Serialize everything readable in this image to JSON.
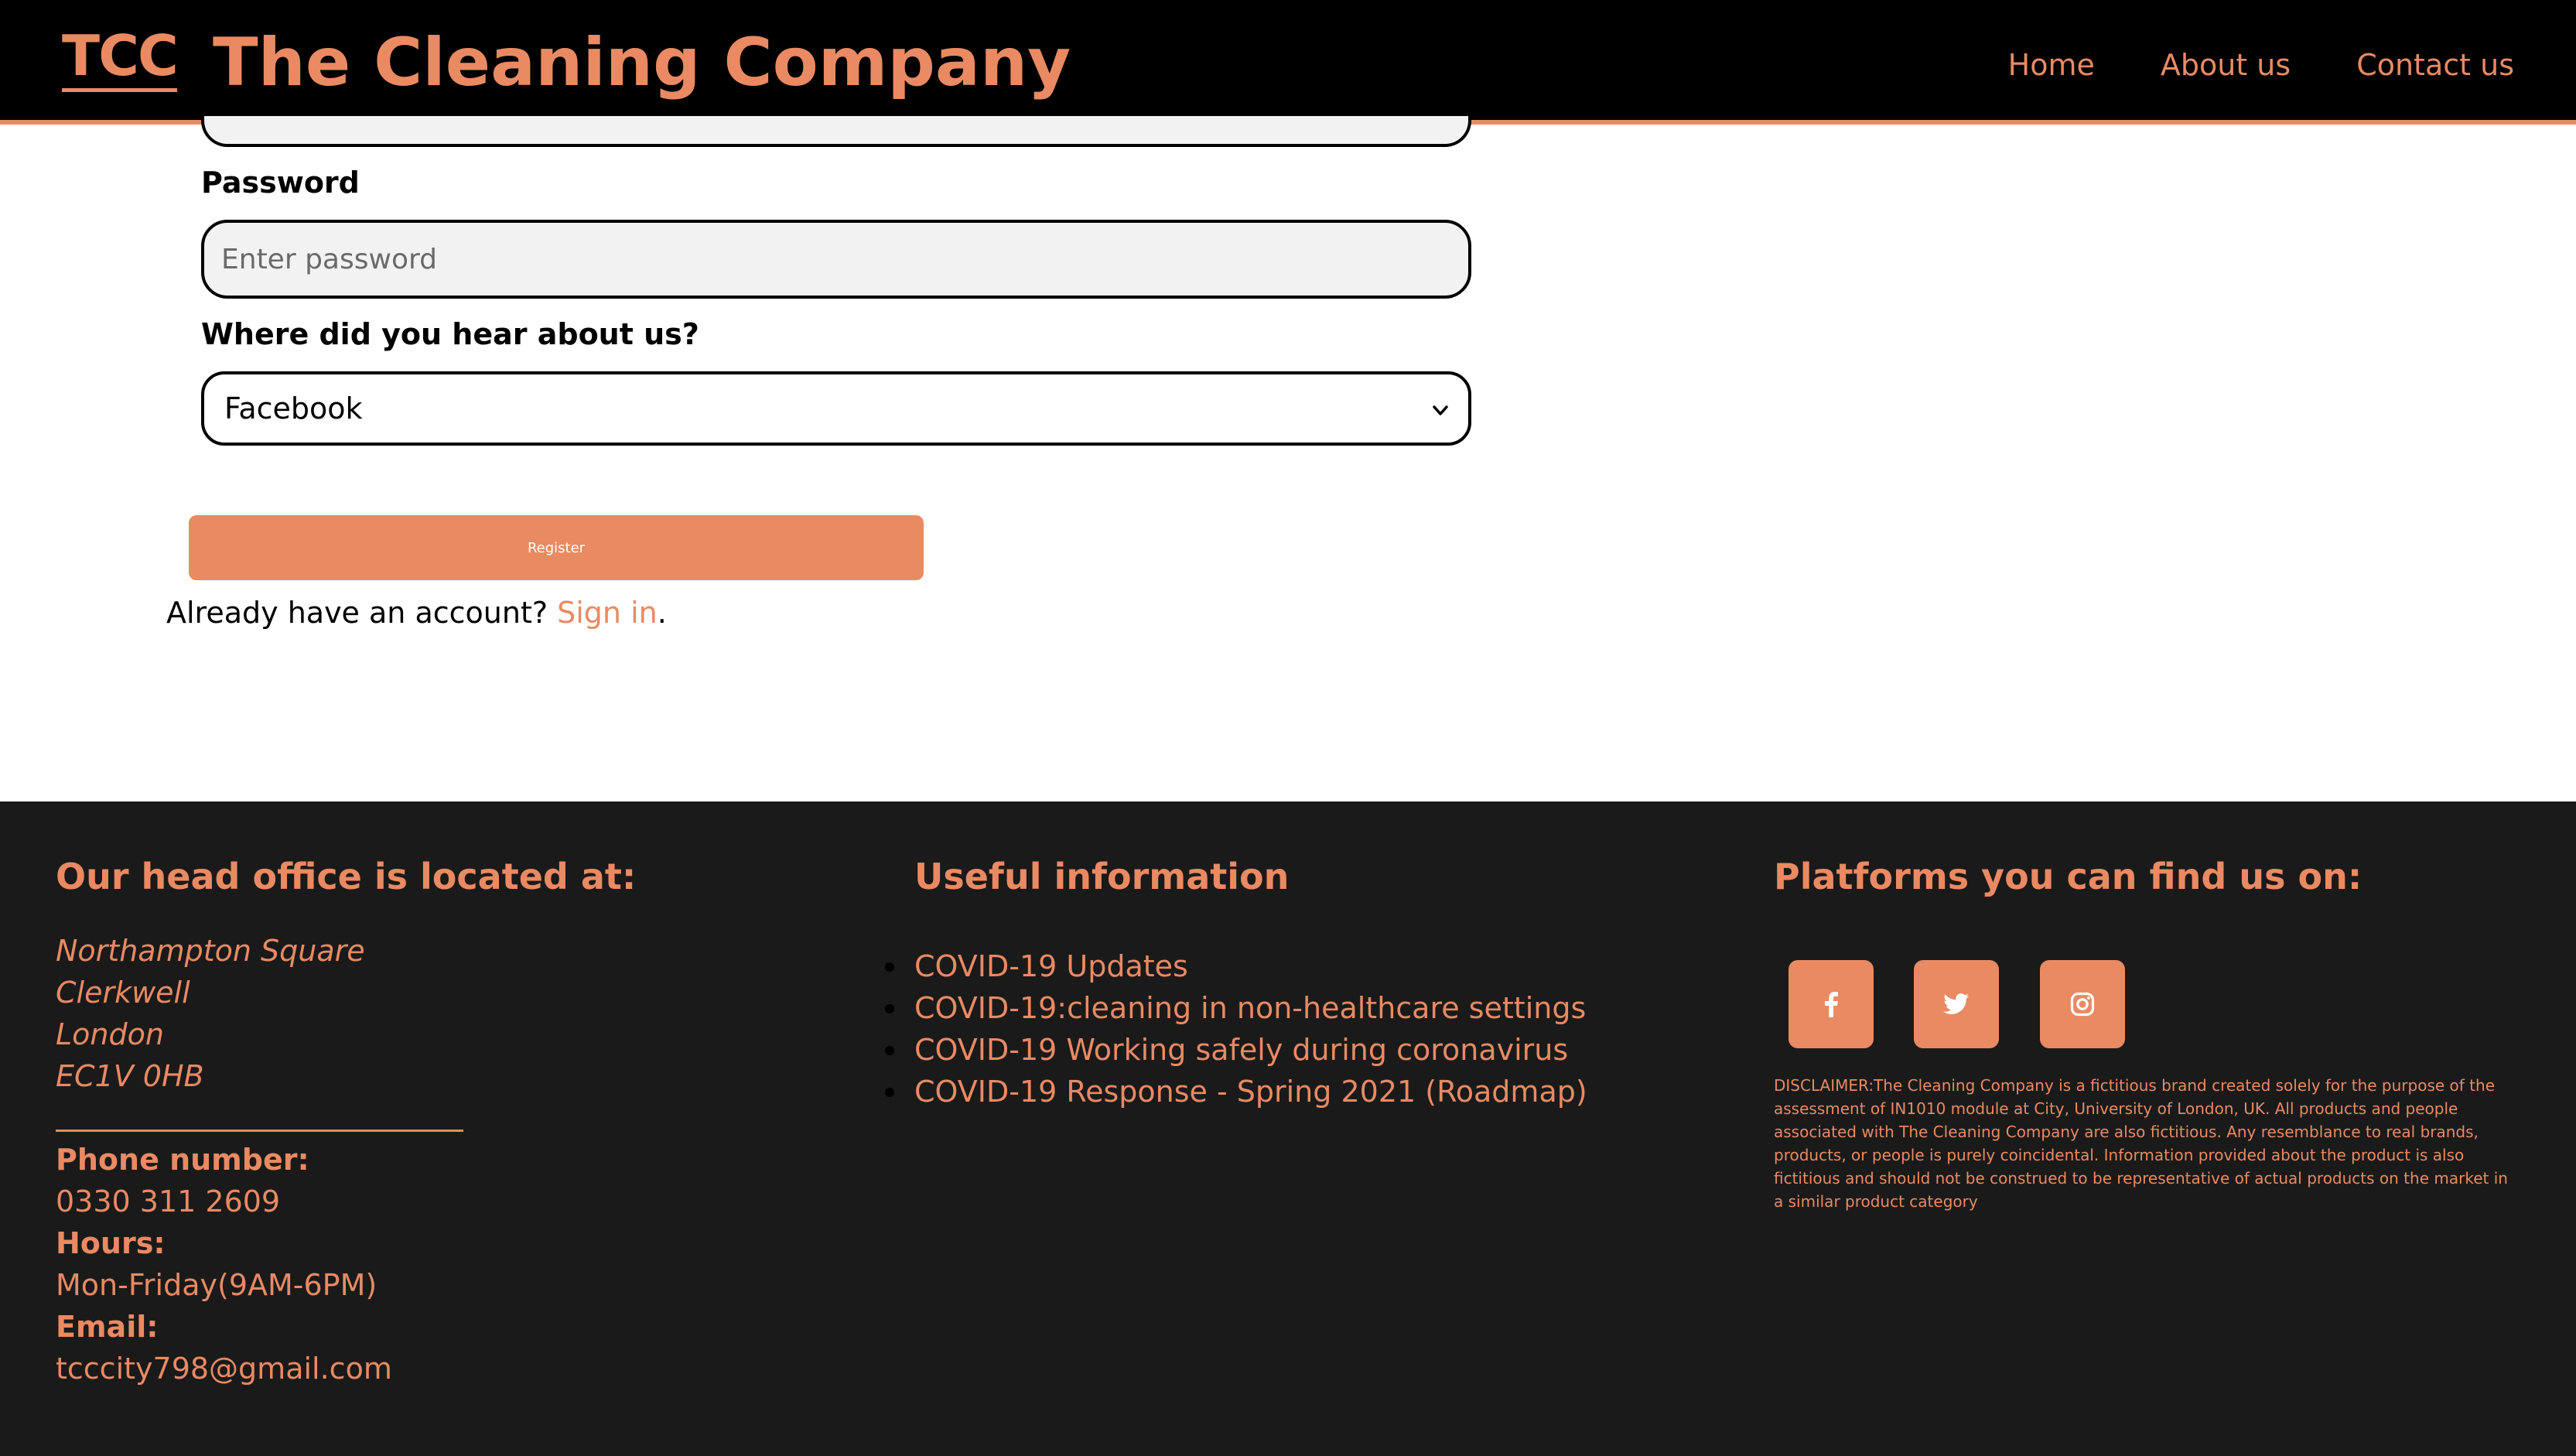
{
  "header": {
    "logo": "TCC",
    "brand": "The Cleaning Company",
    "nav": [
      "Home",
      "About us",
      "Contact us"
    ]
  },
  "form": {
    "password_label": "Password",
    "password_placeholder": "Enter password",
    "hear_label": "Where did you hear about us?",
    "hear_selected": "Facebook",
    "register_label": "Register",
    "signin_prefix": "Already have an account?",
    "signin_link": "Sign in",
    "signin_suffix": "."
  },
  "footer": {
    "office": {
      "heading": "Our head office is located at:",
      "address": [
        "Northampton Square",
        "Clerkwell",
        "London",
        "EC1V 0HB"
      ],
      "phone_label": "Phone number:",
      "phone": "0330 311 2609",
      "hours_label": "Hours:",
      "hours": "Mon-Friday(9AM-6PM)",
      "email_label": "Email:",
      "email": "tcccity798@gmail.com"
    },
    "useful": {
      "heading": "Useful information",
      "links": [
        "COVID-19 Updates",
        "COVID-19:cleaning in non-healthcare settings",
        "COVID-19 Working safely during coronavirus",
        "COVID-19 Response - Spring 2021 (Roadmap)"
      ]
    },
    "platforms": {
      "heading": "Platforms you can find us on:",
      "icons": [
        "facebook-icon",
        "twitter-icon",
        "instagram-icon"
      ],
      "disclaimer": "DISCLAIMER:The Cleaning Company is a fictitious brand created solely for the purpose of the assessment of IN1010 module at City, University of London, UK. All products and people associated with The Cleaning Company are also fictitious. Any resemblance to real brands, products, or people is purely coincidental. Information provided about the product is also fictitious and should not be construed to be representative of actual products on the market in a similar product category"
    }
  },
  "colors": {
    "accent": "#e98a63",
    "header_bg": "#000000",
    "footer_bg": "#1a1a1a"
  }
}
